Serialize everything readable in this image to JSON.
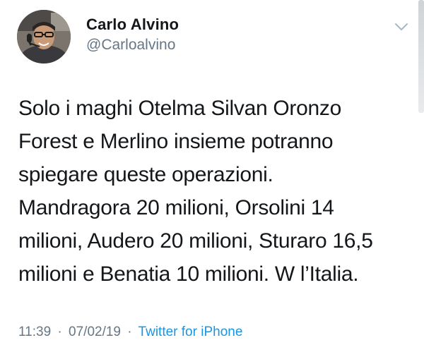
{
  "tweet": {
    "author": {
      "display_name": "Carlo Alvino",
      "handle": "@Carloalvino",
      "avatar_icon": "profile-photo"
    },
    "menu_icon": "chevron-down-icon",
    "text_lines": [
      "Solo i maghi Otelma Silvan Oronzo",
      "Forest e Merlino insieme potranno",
      "spiegare queste operazioni.",
      "Mandragora 20 milioni, Orsolini 14",
      "milioni, Audero 20 milioni, Sturaro 16,5",
      "milioni e Benatia 10 milioni. W l’Italia."
    ],
    "meta": {
      "time": "11:39",
      "separator": "·",
      "date": "07/02/19",
      "source": "Twitter for iPhone"
    }
  },
  "colors": {
    "text": "#14171a",
    "secondary": "#657786",
    "link": "#1b95e0"
  }
}
